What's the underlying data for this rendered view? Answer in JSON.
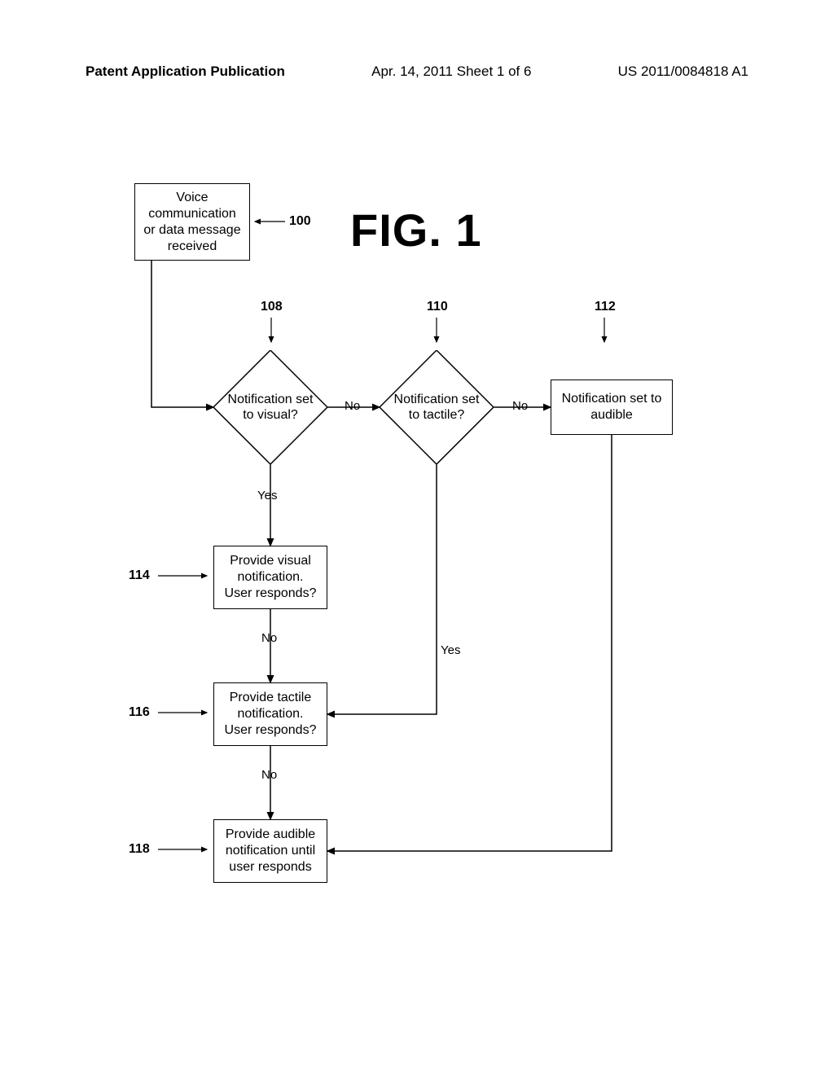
{
  "header": {
    "left": "Patent Application Publication",
    "mid": "Apr. 14, 2011  Sheet 1 of 6",
    "right": "US 2011/0084818 A1"
  },
  "figure_title": "FIG. 1",
  "refs": {
    "ref_100": "100",
    "ref_108": "108",
    "ref_110": "110",
    "ref_112": "112",
    "ref_114": "114",
    "ref_116": "116",
    "ref_118": "118"
  },
  "nodes": {
    "start": "Voice communication or data message received",
    "d108": "Notification set to visual?",
    "d110": "Notification set to tactile?",
    "b112": "Notification set to audible",
    "b114": "Provide visual notification. User responds?",
    "b116": "Provide tactile notification. User responds?",
    "b118": "Provide audible notification until user responds"
  },
  "edges": {
    "no": "No",
    "yes": "Yes"
  }
}
